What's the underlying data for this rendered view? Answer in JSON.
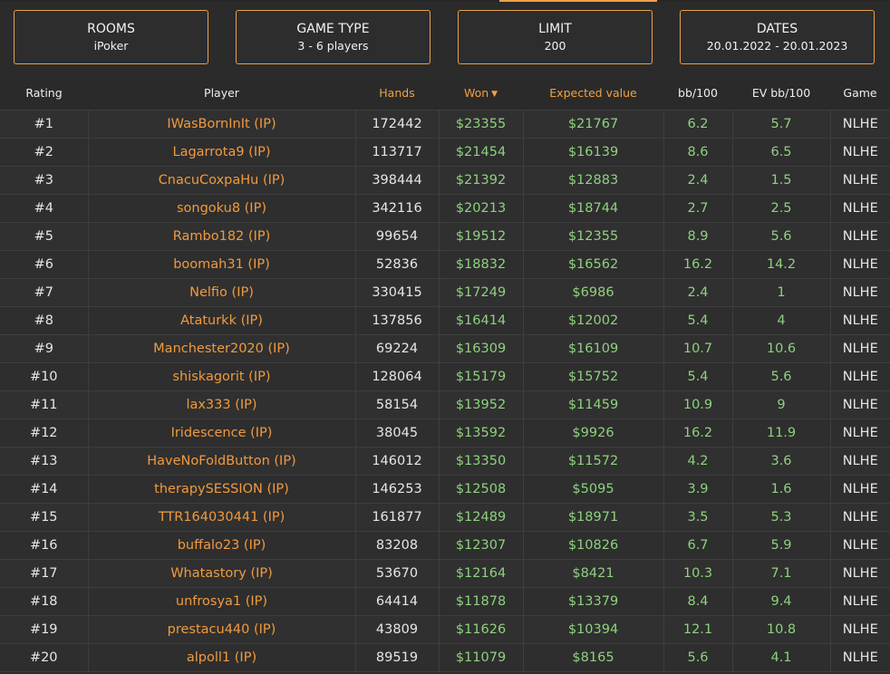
{
  "filters": [
    {
      "title": "ROOMS",
      "value": "iPoker"
    },
    {
      "title": "GAME TYPE",
      "value": "3 - 6 players"
    },
    {
      "title": "LIMIT",
      "value": "200"
    },
    {
      "title": "DATES",
      "value": "20.01.2022 - 20.01.2023"
    }
  ],
  "columns": {
    "rating": "Rating",
    "player": "Player",
    "hands": "Hands",
    "won": "Won",
    "ev": "Expected value",
    "bb100": "bb/100",
    "evbb100": "EV bb/100",
    "game": "Game"
  },
  "sort": {
    "column": "won",
    "direction": "desc",
    "indicator": "caret-down-icon"
  },
  "colors": {
    "accent": "#f0a044",
    "positive": "#8ed17f",
    "background": "#2b2b2b"
  },
  "rows": [
    {
      "rating": "#1",
      "player": "IWasBornInIt (IP)",
      "hands": "172442",
      "won": "$23355",
      "ev": "$21767",
      "bb100": "6.2",
      "evbb100": "5.7",
      "game": "NLHE"
    },
    {
      "rating": "#2",
      "player": "Lagarrota9 (IP)",
      "hands": "113717",
      "won": "$21454",
      "ev": "$16139",
      "bb100": "8.6",
      "evbb100": "6.5",
      "game": "NLHE"
    },
    {
      "rating": "#3",
      "player": "CnacuCoxpaHu (IP)",
      "hands": "398444",
      "won": "$21392",
      "ev": "$12883",
      "bb100": "2.4",
      "evbb100": "1.5",
      "game": "NLHE"
    },
    {
      "rating": "#4",
      "player": "songoku8 (IP)",
      "hands": "342116",
      "won": "$20213",
      "ev": "$18744",
      "bb100": "2.7",
      "evbb100": "2.5",
      "game": "NLHE"
    },
    {
      "rating": "#5",
      "player": "Rambo182 (IP)",
      "hands": "99654",
      "won": "$19512",
      "ev": "$12355",
      "bb100": "8.9",
      "evbb100": "5.6",
      "game": "NLHE"
    },
    {
      "rating": "#6",
      "player": "boomah31 (IP)",
      "hands": "52836",
      "won": "$18832",
      "ev": "$16562",
      "bb100": "16.2",
      "evbb100": "14.2",
      "game": "NLHE"
    },
    {
      "rating": "#7",
      "player": "Nelfio (IP)",
      "hands": "330415",
      "won": "$17249",
      "ev": "$6986",
      "bb100": "2.4",
      "evbb100": "1",
      "game": "NLHE"
    },
    {
      "rating": "#8",
      "player": "Ataturkk (IP)",
      "hands": "137856",
      "won": "$16414",
      "ev": "$12002",
      "bb100": "5.4",
      "evbb100": "4",
      "game": "NLHE"
    },
    {
      "rating": "#9",
      "player": "Manchester2020 (IP)",
      "hands": "69224",
      "won": "$16309",
      "ev": "$16109",
      "bb100": "10.7",
      "evbb100": "10.6",
      "game": "NLHE"
    },
    {
      "rating": "#10",
      "player": "shiskagorit (IP)",
      "hands": "128064",
      "won": "$15179",
      "ev": "$15752",
      "bb100": "5.4",
      "evbb100": "5.6",
      "game": "NLHE"
    },
    {
      "rating": "#11",
      "player": "lax333 (IP)",
      "hands": "58154",
      "won": "$13952",
      "ev": "$11459",
      "bb100": "10.9",
      "evbb100": "9",
      "game": "NLHE"
    },
    {
      "rating": "#12",
      "player": "Iridescence (IP)",
      "hands": "38045",
      "won": "$13592",
      "ev": "$9926",
      "bb100": "16.2",
      "evbb100": "11.9",
      "game": "NLHE"
    },
    {
      "rating": "#13",
      "player": "HaveNoFoldButton (IP)",
      "hands": "146012",
      "won": "$13350",
      "ev": "$11572",
      "bb100": "4.2",
      "evbb100": "3.6",
      "game": "NLHE"
    },
    {
      "rating": "#14",
      "player": "therapySESSION (IP)",
      "hands": "146253",
      "won": "$12508",
      "ev": "$5095",
      "bb100": "3.9",
      "evbb100": "1.6",
      "game": "NLHE"
    },
    {
      "rating": "#15",
      "player": "TTR164030441 (IP)",
      "hands": "161877",
      "won": "$12489",
      "ev": "$18971",
      "bb100": "3.5",
      "evbb100": "5.3",
      "game": "NLHE"
    },
    {
      "rating": "#16",
      "player": "buffalo23 (IP)",
      "hands": "83208",
      "won": "$12307",
      "ev": "$10826",
      "bb100": "6.7",
      "evbb100": "5.9",
      "game": "NLHE"
    },
    {
      "rating": "#17",
      "player": "Whatastory (IP)",
      "hands": "53670",
      "won": "$12164",
      "ev": "$8421",
      "bb100": "10.3",
      "evbb100": "7.1",
      "game": "NLHE"
    },
    {
      "rating": "#18",
      "player": "unfrosya1 (IP)",
      "hands": "64414",
      "won": "$11878",
      "ev": "$13379",
      "bb100": "8.4",
      "evbb100": "9.4",
      "game": "NLHE"
    },
    {
      "rating": "#19",
      "player": "prestacu440 (IP)",
      "hands": "43809",
      "won": "$11626",
      "ev": "$10394",
      "bb100": "12.1",
      "evbb100": "10.8",
      "game": "NLHE"
    },
    {
      "rating": "#20",
      "player": "alpoll1 (IP)",
      "hands": "89519",
      "won": "$11079",
      "ev": "$8165",
      "bb100": "5.6",
      "evbb100": "4.1",
      "game": "NLHE"
    }
  ]
}
